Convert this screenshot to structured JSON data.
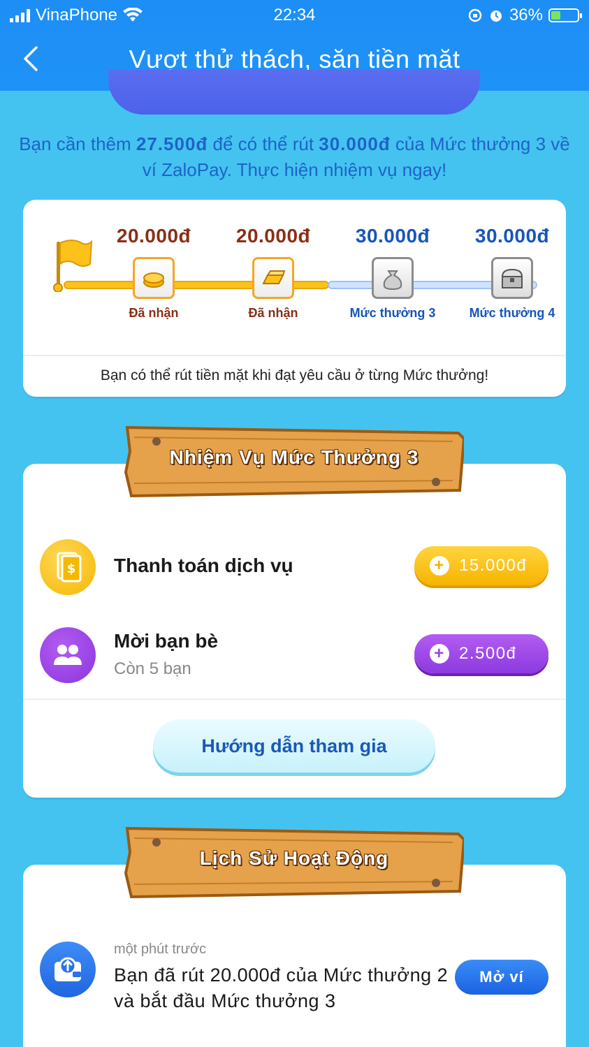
{
  "status_bar": {
    "carrier": "VinaPhone",
    "time": "22:34",
    "battery_percent": "36%",
    "battery_level": 0.36
  },
  "nav": {
    "back_icon": "chevron-left-icon",
    "title": "Vượt thử thách, săn tiền mặt"
  },
  "notice": {
    "part1": "Bạn cần thêm ",
    "needed": "27.500đ",
    "part2": " để có thể rút ",
    "target": "30.000đ",
    "part3": " của Mức thưởng 3 về ví ZaloPay. Thực hiện nhiệm vụ ngay!"
  },
  "levels": {
    "items": [
      {
        "amount": "20.000đ",
        "label": "Đã nhận",
        "icon": "coins-icon"
      },
      {
        "amount": "20.000đ",
        "label": "Đã nhận",
        "icon": "gold-bar-icon"
      },
      {
        "amount": "30.000đ",
        "label": "Mức thưởng 3",
        "icon": "money-bag-icon"
      },
      {
        "amount": "30.000đ",
        "label": "Mức thưởng 4",
        "icon": "treasure-chest-icon"
      }
    ],
    "hint": "Bạn có thể rút tiền mặt khi đạt yêu cầu ở từng Mức thưởng!"
  },
  "tasks_section": {
    "title": "Nhiệm Vụ Mức Thưởng 3",
    "tasks": [
      {
        "name": "Thanh toán dịch vụ",
        "sub": "",
        "reward": "15.000đ",
        "icon": "receipt-dollar-icon"
      },
      {
        "name": "Mời bạn bè",
        "sub": "Còn 5 bạn",
        "reward": "2.500đ",
        "icon": "users-icon"
      }
    ],
    "guide_button": "Hướng dẫn tham gia"
  },
  "history_section": {
    "title": "Lịch Sử Hoạt Động",
    "entries": [
      {
        "time": "một phút trước",
        "text": "Bạn đã rút 20.000đ của Mức thưởng 2 và bắt đầu Mức thưởng 3",
        "button": "Mở ví",
        "icon": "wallet-withdraw-icon"
      }
    ]
  },
  "colors": {
    "header_blue": "#1d8ef5",
    "background": "#44c3f0",
    "gold": "#fdc21a",
    "purple": "#9b45e4",
    "brown": "#8a2f16",
    "level_blue": "#1656b8"
  }
}
